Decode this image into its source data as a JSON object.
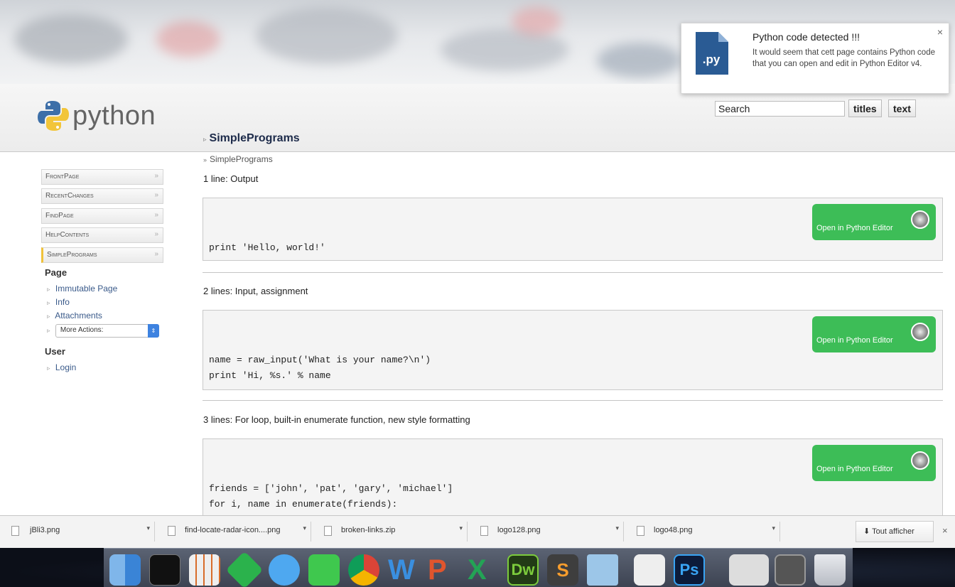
{
  "header": {
    "logo_text": "python",
    "search_value": "Search",
    "titles_button": "titles",
    "text_button": "text",
    "page_title": "SimplePrograms"
  },
  "notification": {
    "title": "Python code detected !!!",
    "body": "It would seem that cett page contains Python code that you can open and edit in Python Editor v4.",
    "icon_text": ".py"
  },
  "sidebar": {
    "items": [
      {
        "label": "FrontPage"
      },
      {
        "label": "RecentChanges"
      },
      {
        "label": "FindPage"
      },
      {
        "label": "HelpContents"
      },
      {
        "label": "SimplePrograms"
      }
    ],
    "page_heading": "Page",
    "page_links": [
      "Immutable Page",
      "Info",
      "Attachments"
    ],
    "more_actions": "More Actions:",
    "user_heading": "User",
    "user_links": [
      "Login"
    ]
  },
  "main": {
    "breadcrumb": "SimplePrograms",
    "open_button_label": "Open in Python Editor",
    "sections": [
      {
        "title": "1 line: Output",
        "code": "print 'Hello, world!'"
      },
      {
        "title": "2 lines: Input, assignment",
        "code": "name = raw_input('What is your name?\\n')\nprint 'Hi, %s.' % name"
      },
      {
        "title": "3 lines: For loop, built-in enumerate function, new style formatting",
        "code": "friends = ['john', 'pat', 'gary', 'michael']\nfor i, name in enumerate(friends):"
      }
    ]
  },
  "downloads": {
    "items": [
      "jBli3.png",
      "find-locate-radar-icon....png",
      "broken-links.zip",
      "logo128.png",
      "logo48.png"
    ],
    "show_all": "Tout afficher"
  },
  "colors": {
    "open_button": "#3dbd57",
    "title_blue": "#1d2b4a"
  },
  "dock": {
    "apps": [
      "finder-icon",
      "terminal-icon",
      "calculator-icon",
      "feedly-icon",
      "messages-icon",
      "facetime-icon",
      "chrome-icon",
      "word-icon",
      "powerpoint-icon",
      "excel-icon",
      "dreamweaver-icon",
      "sublime-icon",
      "virtualbox-icon",
      "launchpad-icon",
      "photoshop-icon",
      "keyboard-icon",
      "screenshot-icon",
      "trash-icon"
    ]
  }
}
